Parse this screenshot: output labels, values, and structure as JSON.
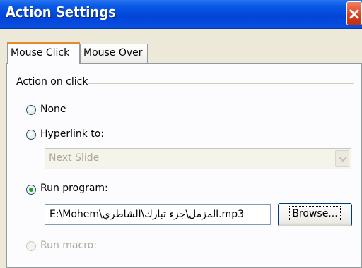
{
  "window": {
    "title": "Action Settings"
  },
  "tabs": [
    {
      "label": "Mouse Click",
      "active": true
    },
    {
      "label": "Mouse Over",
      "active": false
    }
  ],
  "group": {
    "label": "Action on click"
  },
  "options": {
    "none": {
      "label": "None",
      "checked": false
    },
    "hyperlink": {
      "label": "Hyperlink to:",
      "checked": false
    },
    "run_program": {
      "label": "Run program:",
      "checked": true
    },
    "run_macro": {
      "label": "Run macro:",
      "checked": false,
      "disabled": true
    }
  },
  "hyperlink_select": {
    "value": "Next Slide",
    "disabled": true
  },
  "program_path": {
    "value": "E:\\Mohem\\المزمل\\جزء تبارك\\الشاطري.mp3"
  },
  "browse_button": {
    "label": "Browse..."
  },
  "colors": {
    "title_bar": "#0a5ae6",
    "close_button": "#d84020",
    "dialog_bg": "#ece9d8",
    "active_tab_accent": "#e68b2c",
    "radio_checked": "#21a121"
  },
  "icons": {
    "close": "close-icon",
    "dropdown": "chevron-down-icon"
  }
}
